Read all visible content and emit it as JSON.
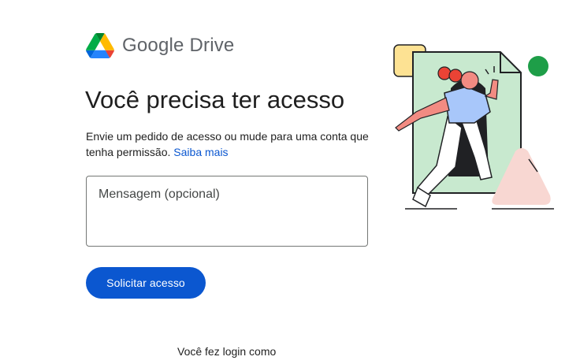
{
  "brand": {
    "google": "Google",
    "product": "Drive",
    "logo_icon": "google-drive-logo"
  },
  "main": {
    "title": "Você precisa ter acesso",
    "description": "Envie um pedido de acesso ou mude para uma conta que tenha permissão.",
    "learn_more": "Saiba mais",
    "message_placeholder": "Mensagem (opcional)",
    "message_value": "",
    "request_button": "Solicitar acesso",
    "login_prefix": "Você fez login como"
  },
  "colors": {
    "accent": "#0b57d0",
    "text": "#1f1f1f",
    "brand_text": "#5f6368",
    "illustration_green": "#c8e9cf",
    "illustration_yellow": "#fde293",
    "illustration_pink": "#f8d7d2",
    "illustration_dot": "#1e9e48"
  },
  "illustration": {
    "icon": "person-entering-door-illustration"
  }
}
